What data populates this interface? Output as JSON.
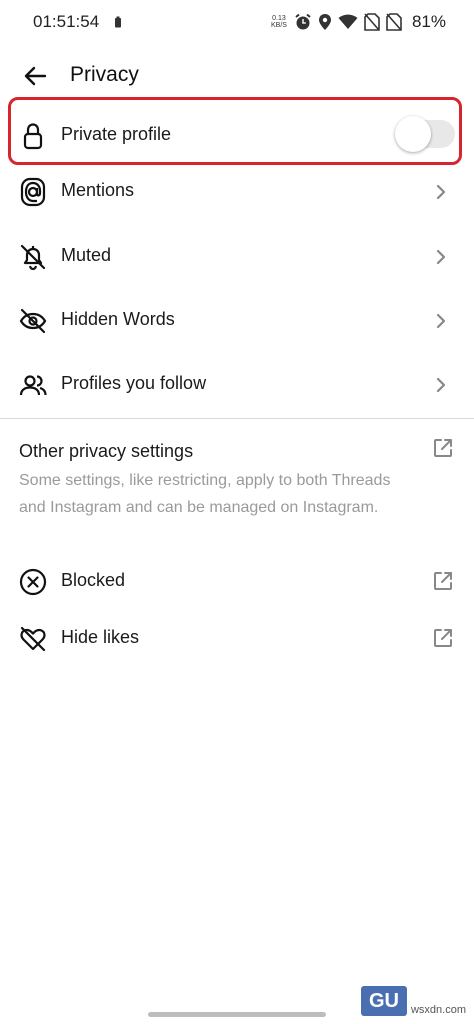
{
  "status_bar": {
    "time": "01:51:54",
    "net_speed_value": "0.13",
    "net_speed_unit": "KB/S",
    "battery_percent": "81%"
  },
  "header": {
    "title": "Privacy"
  },
  "rows": {
    "private_profile": {
      "label": "Private profile",
      "toggle_on": false
    },
    "mentions": {
      "label": "Mentions"
    },
    "muted": {
      "label": "Muted"
    },
    "hidden_words": {
      "label": "Hidden Words"
    },
    "profiles_you_follow": {
      "label": "Profiles you follow"
    }
  },
  "other_section": {
    "title": "Other privacy settings",
    "description": "Some settings, like restricting, apply to both Threads and Instagram and can be managed on Instagram.",
    "blocked": {
      "label": "Blocked"
    },
    "hide_likes": {
      "label": "Hide likes"
    }
  },
  "watermark": {
    "logo_text": "GU",
    "site": "wsxdn.com"
  },
  "colors": {
    "highlight": "#d6262c",
    "toggle_track": "#e8e8e8",
    "muted_text": "#9a9a9a"
  }
}
